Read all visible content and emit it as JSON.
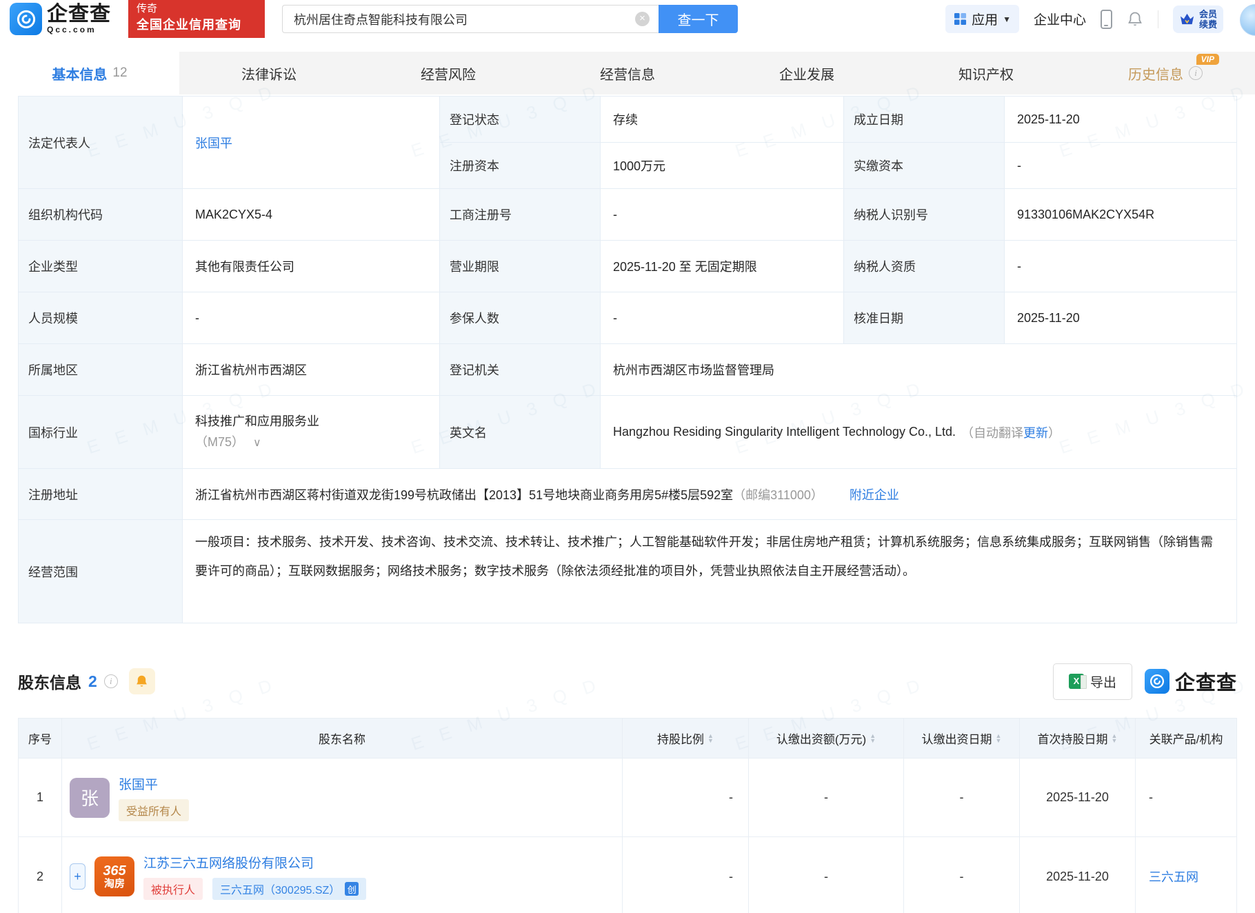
{
  "colors": {
    "brand_blue": "#2d7de1",
    "button_blue": "#4191f5",
    "promo_red": "#d8342c",
    "label_cell_bg": "#f2f7fb",
    "vip_gold": "#c59a5b",
    "badge_tan_text": "#b4874a",
    "badge_red_text": "#e0413d",
    "badge_blue_text": "#3584e4",
    "avatar_purple": "#b3a6c2",
    "logo_365_orange": "#e8651a"
  },
  "watermark": "E E M U 3 Q D",
  "header": {
    "logo_text": "企查查",
    "logo_sub": "Qcc.com",
    "promo_line1": "传奇",
    "promo_line2": "全国企业信用查询",
    "search_value": "杭州居住奇点智能科技有限公司",
    "search_button": "查一下",
    "apps_label": "应用",
    "enterprise_center": "企业中心",
    "vip_line1": "会员",
    "vip_line2": "续费"
  },
  "tabs": [
    {
      "label": "基本信息",
      "count": "12"
    },
    {
      "label": "法律诉讼"
    },
    {
      "label": "经营风险"
    },
    {
      "label": "经营信息"
    },
    {
      "label": "企业发展"
    },
    {
      "label": "知识产权"
    },
    {
      "label": "历史信息",
      "vip_badge": "VIP"
    }
  ],
  "basic_info": {
    "legal_rep_label": "法定代表人",
    "legal_rep": "张国平",
    "reg_status_label": "登记状态",
    "reg_status": "存续",
    "establish_date_label": "成立日期",
    "establish_date": "2025-11-20",
    "reg_capital_label": "注册资本",
    "reg_capital": "1000万元",
    "paid_capital_label": "实缴资本",
    "paid_capital": "-",
    "org_code_label": "组织机构代码",
    "org_code": "MAK2CYX5-4",
    "biz_reg_no_label": "工商注册号",
    "biz_reg_no": "-",
    "taxpayer_id_label": "纳税人识别号",
    "taxpayer_id": "91330106MAK2CYX54R",
    "company_type_label": "企业类型",
    "company_type": "其他有限责任公司",
    "biz_term_label": "营业期限",
    "biz_term": "2025-11-20 至 无固定期限",
    "taxpayer_quality_label": "纳税人资质",
    "taxpayer_quality": "-",
    "staff_size_label": "人员规模",
    "staff_size": "-",
    "insured_num_label": "参保人数",
    "insured_num": "-",
    "approve_date_label": "核准日期",
    "approve_date": "2025-11-20",
    "region_label": "所属地区",
    "region": "浙江省杭州市西湖区",
    "reg_authority_label": "登记机关",
    "reg_authority": "杭州市西湖区市场监督管理局",
    "industry_label": "国标行业",
    "industry": "科技推广和应用服务业",
    "industry_code": "（M75）",
    "english_name_label": "英文名",
    "english_name": "Hangzhou Residing Singularity Intelligent Technology Co., Ltd.",
    "english_note_prefix": "（自动翻译",
    "english_note_link": "更新",
    "english_note_suffix": "）",
    "address_label": "注册地址",
    "address": "浙江省杭州市西湖区蒋村街道双龙街199号杭政储出【2013】51号地块商业商务用房5#楼5层592室",
    "address_postcode": "（邮编311000）",
    "nearby_link": "附近企业",
    "scope_label": "经营范围",
    "scope": "一般项目：技术服务、技术开发、技术咨询、技术交流、技术转让、技术推广；人工智能基础软件开发；非居住房地产租赁；计算机系统服务；信息系统集成服务；互联网销售（除销售需要许可的商品）；互联网数据服务；网络技术服务；数字技术服务（除依法须经批准的项目外，凭营业执照依法自主开展经营活动）。"
  },
  "shareholders": {
    "title": "股东信息",
    "count": "2",
    "export_label": "导出",
    "brand_text": "企查查",
    "headers": [
      "序号",
      "股东名称",
      "持股比例",
      "认缴出资额(万元)",
      "认缴出资日期",
      "首次持股日期",
      "关联产品/机构"
    ],
    "rows": [
      {
        "no": "1",
        "avatar": "张",
        "name": "张国平",
        "badge1": "受益所有人",
        "ratio": "-",
        "amount": "-",
        "sub_date": "-",
        "first_date": "2025-11-20",
        "related": "-"
      },
      {
        "no": "2",
        "logo_line1": "365",
        "logo_line2": "淘房",
        "name": "江苏三六五网络股份有限公司",
        "badge1": "被执行人",
        "badge2": "三六五网（300295.SZ）",
        "badge2_icon": "创",
        "ratio": "-",
        "amount": "-",
        "sub_date": "-",
        "first_date": "2025-11-20",
        "related": "三六五网"
      }
    ]
  }
}
